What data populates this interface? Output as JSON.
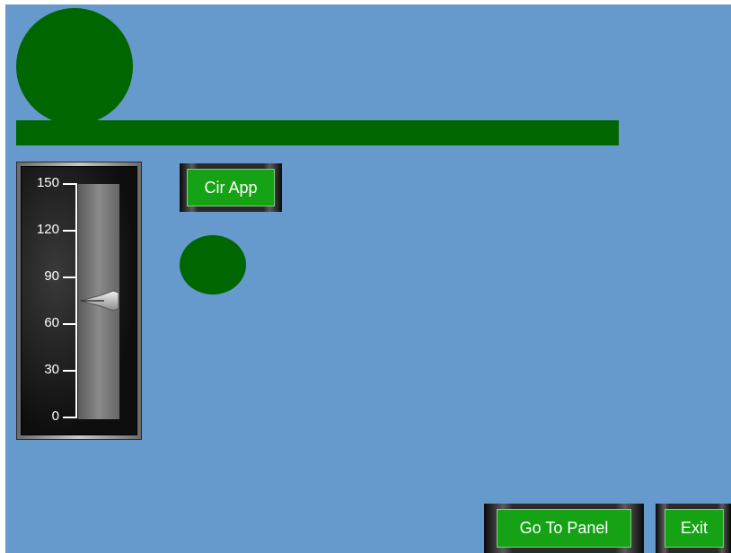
{
  "colors": {
    "background": "#6699cc",
    "shape_green": "#006600",
    "button_green": "#15a315"
  },
  "shapes": {
    "big_circle": "green-circle",
    "bar": "green-bar",
    "small_circle": "green-circle"
  },
  "slider": {
    "ticks": [
      "150",
      "120",
      "90",
      "60",
      "30",
      "0"
    ],
    "min": 0,
    "max": 150,
    "value": 75
  },
  "buttons": {
    "cir_app": "Cir App",
    "go_to_panel": "Go To Panel",
    "exit": "Exit"
  }
}
